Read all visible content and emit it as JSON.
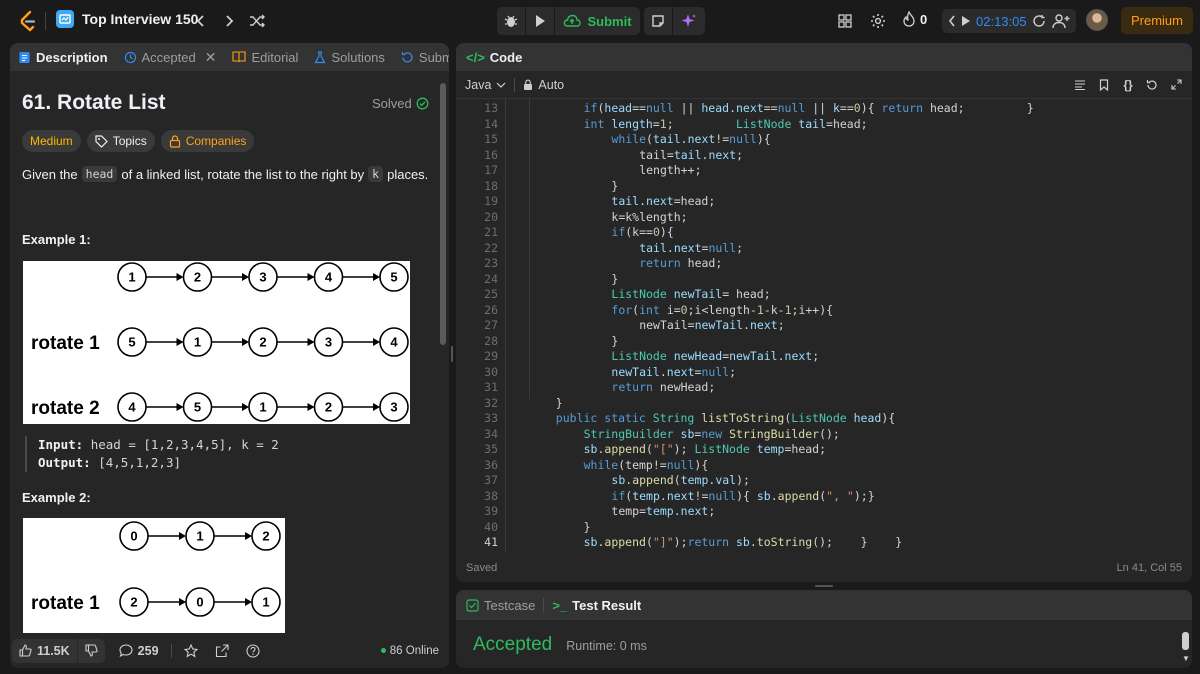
{
  "topbar": {
    "list_title": "Top Interview 150",
    "submit_label": "Submit",
    "streak_count": "0",
    "timer": "02:13:05",
    "premium_label": "Premium"
  },
  "left_tabs": {
    "description": "Description",
    "accepted": "Accepted",
    "editorial": "Editorial",
    "solutions": "Solutions",
    "submissions": "Submissi"
  },
  "problem": {
    "title": "61. Rotate List",
    "status": "Solved",
    "difficulty": "Medium",
    "topics_label": "Topics",
    "companies_label": "Companies",
    "desc_1": "Given the",
    "desc_head": "head",
    "desc_2": "of a linked list, rotate the list to the right by",
    "desc_k": "k",
    "desc_3": "places.",
    "example1_title": "Example 1:",
    "example1_input_label": "Input:",
    "example1_input": "head = [1,2,3,4,5], k = 2",
    "example1_output_label": "Output:",
    "example1_output": "[4,5,1,2,3]",
    "example2_title": "Example 2:",
    "diagram1": {
      "row0": [
        "1",
        "2",
        "3",
        "4",
        "5"
      ],
      "row1_label": "rotate 1",
      "row1": [
        "5",
        "1",
        "2",
        "3",
        "4"
      ],
      "row2_label": "rotate 2",
      "row2": [
        "4",
        "5",
        "1",
        "2",
        "3"
      ]
    },
    "diagram2": {
      "row0": [
        "0",
        "1",
        "2"
      ],
      "row1_label": "rotate 1",
      "row1": [
        "2",
        "0",
        "1"
      ]
    }
  },
  "bottom_bar": {
    "likes": "11.5K",
    "comments": "259",
    "online": "86 Online"
  },
  "code_panel": {
    "title": "Code",
    "language": "Java",
    "mode": "Auto",
    "saved": "Saved",
    "cursor": "Ln 41, Col 55"
  },
  "code_lines": [
    {
      "n": "13",
      "indent": 4
    },
    {
      "n": "14",
      "indent": 4
    },
    {
      "n": "15",
      "indent": 6
    },
    {
      "n": "16",
      "indent": 8
    },
    {
      "n": "17",
      "indent": 8
    },
    {
      "n": "18",
      "indent": 6
    },
    {
      "n": "19",
      "indent": 6
    },
    {
      "n": "20",
      "indent": 6
    },
    {
      "n": "21",
      "indent": 6
    },
    {
      "n": "22",
      "indent": 8
    },
    {
      "n": "23",
      "indent": 8
    },
    {
      "n": "24",
      "indent": 6
    },
    {
      "n": "25",
      "indent": 6
    },
    {
      "n": "26",
      "indent": 6
    },
    {
      "n": "27",
      "indent": 8
    },
    {
      "n": "28",
      "indent": 6
    },
    {
      "n": "29",
      "indent": 6
    },
    {
      "n": "30",
      "indent": 6
    },
    {
      "n": "31",
      "indent": 6
    },
    {
      "n": "32",
      "indent": 2
    },
    {
      "n": "33",
      "indent": 2
    },
    {
      "n": "34",
      "indent": 4
    },
    {
      "n": "35",
      "indent": 4
    },
    {
      "n": "36",
      "indent": 4
    },
    {
      "n": "37",
      "indent": 6
    },
    {
      "n": "38",
      "indent": 6
    },
    {
      "n": "39",
      "indent": 6
    },
    {
      "n": "40",
      "indent": 4
    },
    {
      "n": "41",
      "indent": 4
    }
  ],
  "code_text": [
    [
      [
        "kw",
        "if"
      ],
      [
        "pl",
        "("
      ],
      [
        "vr",
        "head"
      ],
      [
        "pl",
        "=="
      ],
      [
        "kw",
        "null"
      ],
      [
        "pl",
        " || "
      ],
      [
        "vr",
        "head"
      ],
      [
        "pl",
        "."
      ],
      [
        "vr",
        "next"
      ],
      [
        "pl",
        "=="
      ],
      [
        "kw",
        "null"
      ],
      [
        "pl",
        " || "
      ],
      [
        "vr",
        "k"
      ],
      [
        "pl",
        "=="
      ],
      [
        "nm",
        "0"
      ],
      [
        "pl",
        "){ "
      ],
      [
        "kw",
        "return"
      ],
      [
        "pl",
        " head;         }"
      ]
    ],
    [
      [
        "kw",
        "int"
      ],
      [
        "pl",
        " "
      ],
      [
        "vr",
        "length"
      ],
      [
        "pl",
        "="
      ],
      [
        "nm",
        "1"
      ],
      [
        "pl",
        ";         "
      ],
      [
        "ty",
        "ListNode"
      ],
      [
        "pl",
        " "
      ],
      [
        "vr",
        "tail"
      ],
      [
        "pl",
        "=head;"
      ]
    ],
    [
      [
        "kw",
        "while"
      ],
      [
        "pl",
        "("
      ],
      [
        "vr",
        "tail"
      ],
      [
        "pl",
        "."
      ],
      [
        "vr",
        "next"
      ],
      [
        "pl",
        "!="
      ],
      [
        "kw",
        "null"
      ],
      [
        "pl",
        "){"
      ]
    ],
    [
      [
        "pl",
        "tail="
      ],
      [
        "vr",
        "tail"
      ],
      [
        "pl",
        "."
      ],
      [
        "vr",
        "next"
      ],
      [
        "pl",
        ";"
      ]
    ],
    [
      [
        "pl",
        "length++;"
      ]
    ],
    [
      [
        "pl",
        "}"
      ]
    ],
    [
      [
        "vr",
        "tail"
      ],
      [
        "pl",
        "."
      ],
      [
        "vr",
        "next"
      ],
      [
        "pl",
        "=head;"
      ]
    ],
    [
      [
        "pl",
        "k=k%length;"
      ]
    ],
    [
      [
        "kw",
        "if"
      ],
      [
        "pl",
        "(k=="
      ],
      [
        "nm",
        "0"
      ],
      [
        "pl",
        "){"
      ]
    ],
    [
      [
        "vr",
        "tail"
      ],
      [
        "pl",
        "."
      ],
      [
        "vr",
        "next"
      ],
      [
        "pl",
        "="
      ],
      [
        "kw",
        "null"
      ],
      [
        "pl",
        ";"
      ]
    ],
    [
      [
        "kw",
        "return"
      ],
      [
        "pl",
        " head;"
      ]
    ],
    [
      [
        "pl",
        "}"
      ]
    ],
    [
      [
        "ty",
        "ListNode"
      ],
      [
        "pl",
        " "
      ],
      [
        "vr",
        "newTail"
      ],
      [
        "pl",
        "= head;"
      ]
    ],
    [
      [
        "kw",
        "for"
      ],
      [
        "pl",
        "("
      ],
      [
        "kw",
        "int"
      ],
      [
        "pl",
        " i="
      ],
      [
        "nm",
        "0"
      ],
      [
        "pl",
        ";i<length-"
      ],
      [
        "nm",
        "1"
      ],
      [
        "pl",
        "-"
      ],
      [
        "pl",
        "k-"
      ],
      [
        "nm",
        "1"
      ],
      [
        "pl",
        ";i++){"
      ]
    ],
    [
      [
        "pl",
        "newTail="
      ],
      [
        "vr",
        "newTail"
      ],
      [
        "pl",
        "."
      ],
      [
        "vr",
        "next"
      ],
      [
        "pl",
        ";"
      ]
    ],
    [
      [
        "pl",
        "}"
      ]
    ],
    [
      [
        "ty",
        "ListNode"
      ],
      [
        "pl",
        " "
      ],
      [
        "vr",
        "newHead"
      ],
      [
        "pl",
        "="
      ],
      [
        "vr",
        "newTail"
      ],
      [
        "pl",
        "."
      ],
      [
        "vr",
        "next"
      ],
      [
        "pl",
        ";"
      ]
    ],
    [
      [
        "vr",
        "newTail"
      ],
      [
        "pl",
        "."
      ],
      [
        "vr",
        "next"
      ],
      [
        "pl",
        "="
      ],
      [
        "kw",
        "null"
      ],
      [
        "pl",
        ";"
      ]
    ],
    [
      [
        "kw",
        "return"
      ],
      [
        "pl",
        " newHead;"
      ]
    ],
    [
      [
        "pl",
        "}"
      ]
    ],
    [
      [
        "kw",
        "public"
      ],
      [
        "pl",
        " "
      ],
      [
        "kw",
        "static"
      ],
      [
        "pl",
        " "
      ],
      [
        "ty",
        "String"
      ],
      [
        "pl",
        " "
      ],
      [
        "fn",
        "listToString"
      ],
      [
        "pl",
        "("
      ],
      [
        "ty",
        "ListNode"
      ],
      [
        "pl",
        " "
      ],
      [
        "vr",
        "head"
      ],
      [
        "pl",
        "){"
      ]
    ],
    [
      [
        "ty",
        "StringBuilder"
      ],
      [
        "pl",
        " "
      ],
      [
        "vr",
        "sb"
      ],
      [
        "pl",
        "="
      ],
      [
        "kw",
        "new"
      ],
      [
        "pl",
        " "
      ],
      [
        "fn",
        "StringBuilder"
      ],
      [
        "pl",
        "();"
      ]
    ],
    [
      [
        "vr",
        "sb"
      ],
      [
        "pl",
        "."
      ],
      [
        "fn",
        "append"
      ],
      [
        "pl",
        "("
      ],
      [
        "st",
        "\"[\""
      ],
      [
        "pl",
        "); "
      ],
      [
        "ty",
        "ListNode"
      ],
      [
        "pl",
        " "
      ],
      [
        "vr",
        "temp"
      ],
      [
        "pl",
        "=head;"
      ]
    ],
    [
      [
        "kw",
        "while"
      ],
      [
        "pl",
        "(temp!="
      ],
      [
        "kw",
        "null"
      ],
      [
        "pl",
        "){"
      ]
    ],
    [
      [
        "vr",
        "sb"
      ],
      [
        "pl",
        "."
      ],
      [
        "fn",
        "append"
      ],
      [
        "pl",
        "("
      ],
      [
        "vr",
        "temp"
      ],
      [
        "pl",
        "."
      ],
      [
        "vr",
        "val"
      ],
      [
        "pl",
        ");"
      ]
    ],
    [
      [
        "kw",
        "if"
      ],
      [
        "pl",
        "("
      ],
      [
        "vr",
        "temp"
      ],
      [
        "pl",
        "."
      ],
      [
        "vr",
        "next"
      ],
      [
        "pl",
        "!="
      ],
      [
        "kw",
        "null"
      ],
      [
        "pl",
        "){ "
      ],
      [
        "vr",
        "sb"
      ],
      [
        "pl",
        "."
      ],
      [
        "fn",
        "append"
      ],
      [
        "pl",
        "("
      ],
      [
        "st",
        "\", \""
      ],
      [
        "pl",
        ");}"
      ]
    ],
    [
      [
        "pl",
        "temp="
      ],
      [
        "vr",
        "temp"
      ],
      [
        "pl",
        "."
      ],
      [
        "vr",
        "next"
      ],
      [
        "pl",
        ";"
      ]
    ],
    [
      [
        "pl",
        "}"
      ]
    ],
    [
      [
        "vr",
        "sb"
      ],
      [
        "pl",
        "."
      ],
      [
        "fn",
        "append"
      ],
      [
        "pl",
        "("
      ],
      [
        "st",
        "\"]\""
      ],
      [
        "pl",
        ");"
      ],
      [
        "kw",
        "return"
      ],
      [
        "pl",
        " "
      ],
      [
        "vr",
        "sb"
      ],
      [
        "pl",
        "."
      ],
      [
        "fn",
        "toString"
      ],
      [
        "pl",
        "();    }    }"
      ]
    ]
  ],
  "result_panel": {
    "testcase_tab": "Testcase",
    "result_tab": "Test Result",
    "verdict": "Accepted",
    "runtime": "Runtime: 0 ms"
  },
  "colors": {
    "accent_orange": "#ffa116",
    "green": "#2cbb5d",
    "blue_timer": "#2f8cf5",
    "ai_purple": "#a970ff"
  }
}
